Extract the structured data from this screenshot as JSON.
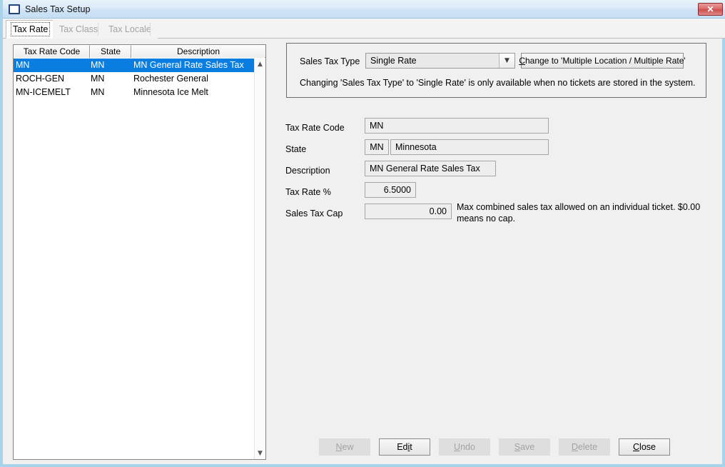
{
  "window": {
    "title": "Sales Tax Setup",
    "icon": "window-icon",
    "close_label": "✕"
  },
  "tabs": [
    {
      "label": "Tax Rate",
      "active": true,
      "enabled": true
    },
    {
      "label": "Tax Class",
      "active": false,
      "enabled": false
    },
    {
      "label": "Tax Locale",
      "active": false,
      "enabled": false
    }
  ],
  "list": {
    "columns": [
      "Tax Rate Code",
      "State",
      "Description"
    ],
    "rows": [
      {
        "code": "MN",
        "state": "MN",
        "description": "MN General Rate Sales Tax",
        "selected": true
      },
      {
        "code": "ROCH-GEN",
        "state": "MN",
        "description": "Rochester General",
        "selected": false
      },
      {
        "code": "MN-ICEMELT",
        "state": "MN",
        "description": "Minnesota Ice Melt",
        "selected": false
      }
    ],
    "scroll_up_icon": "chevron-up-icon",
    "scroll_down_icon": "chevron-down-icon",
    "selection_color": "#0a7ee0"
  },
  "tax_type_panel": {
    "label": "Sales Tax Type",
    "selected_option": "Single Rate",
    "options": [
      "Single Rate"
    ],
    "dropdown_icon": "chevron-down-icon",
    "change_button": "Change to 'Multiple Location / Multiple Rate'",
    "change_button_accel": "C",
    "note": "Changing 'Sales Tax Type' to 'Single Rate' is only available when no tickets are stored in the system."
  },
  "form": {
    "tax_rate_code": {
      "label": "Tax Rate Code",
      "value": "MN"
    },
    "state": {
      "label": "State",
      "code": "MN",
      "name": "Minnesota"
    },
    "description": {
      "label": "Description",
      "value": "MN General Rate Sales Tax"
    },
    "tax_rate_pct": {
      "label": "Tax Rate %",
      "value": "6.5000"
    },
    "sales_tax_cap": {
      "label": "Sales Tax Cap",
      "value": "0.00",
      "help": "Max combined sales tax allowed on an individual ticket.  $0.00 means no cap."
    }
  },
  "buttons": [
    {
      "label": "New",
      "accel": "N",
      "enabled": false
    },
    {
      "label": "Edit",
      "accel": "i",
      "enabled": true
    },
    {
      "label": "Undo",
      "accel": "U",
      "enabled": false
    },
    {
      "label": "Save",
      "accel": "S",
      "enabled": false
    },
    {
      "label": "Delete",
      "accel": "D",
      "enabled": false
    },
    {
      "label": "Close",
      "accel": "C",
      "enabled": true
    }
  ]
}
